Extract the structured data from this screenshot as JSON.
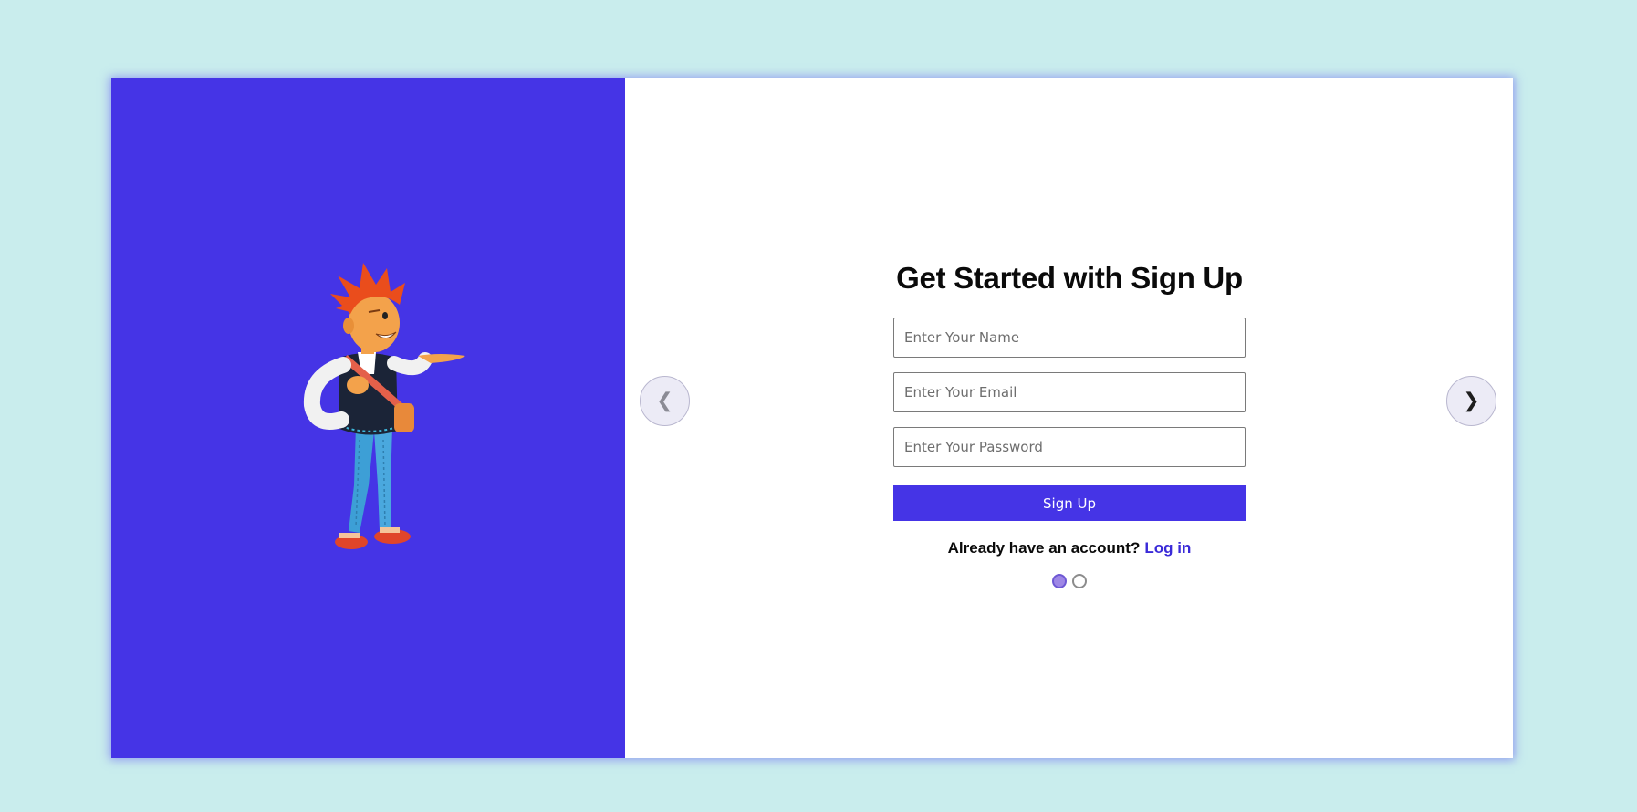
{
  "illustration": {
    "icon": "cartoon-character-illustration"
  },
  "form": {
    "title": "Get Started with Sign Up",
    "name_placeholder": "Enter Your Name",
    "email_placeholder": "Enter Your Email",
    "password_placeholder": "Enter Your Password",
    "submit_label": "Sign Up",
    "login_prompt": "Already have an account?",
    "login_link": "Log in"
  },
  "carousel": {
    "prev_icon": "❮",
    "next_icon": "❯",
    "slide_count": 2,
    "active_slide": 1
  },
  "colors": {
    "page_background": "#c9eded",
    "accent": "#4534e6",
    "link": "#3a2ad8"
  }
}
